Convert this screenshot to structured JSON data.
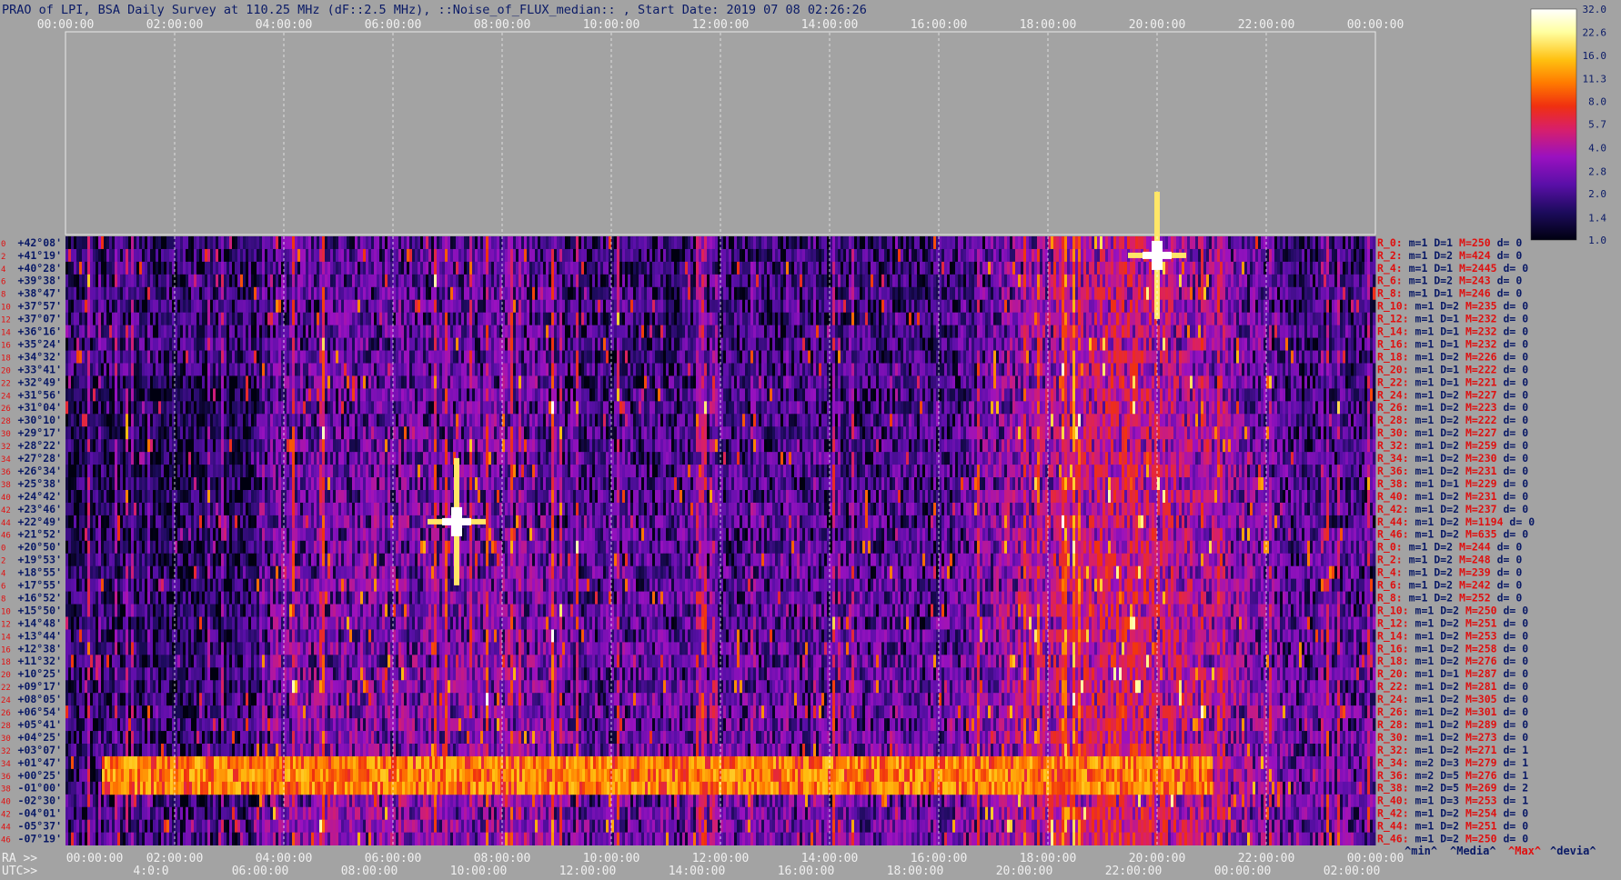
{
  "chart_data": {
    "type": "heatmap",
    "title": "PRAO of LPI, BSA Daily Survey at 110.25 MHz (dF::2.5 MHz), ::Noise_of_FLUX_median:: , Start Date: 2019 07 08 02:26:26",
    "x_top_ticks": [
      "00:00:00",
      "02:00:00",
      "04:00:00",
      "06:00:00",
      "08:00:00",
      "10:00:00",
      "12:00:00",
      "14:00:00",
      "16:00:00",
      "18:00:00",
      "20:00:00",
      "22:00:00",
      "00:00:00"
    ],
    "x_ra_label": "RA >>",
    "x_ra_ticks": [
      "00:00:00",
      "02:00:00",
      "04:00:00",
      "06:00:00",
      "08:00:00",
      "10:00:00",
      "12:00:00",
      "14:00:00",
      "16:00:00",
      "18:00:00",
      "20:00:00",
      "22:00:00",
      "00:00:00"
    ],
    "x_utc_label": "UTC>>",
    "x_utc_ticks": [
      "4:0:0",
      "06:00:00",
      "08:00:00",
      "10:00:00",
      "12:00:00",
      "14:00:00",
      "16:00:00",
      "18:00:00",
      "20:00:00",
      "22:00:00",
      "00:00:00",
      "02:00:00"
    ],
    "row_index_labels": [
      "0",
      "2",
      "4",
      "6",
      "8",
      "10",
      "12",
      "14",
      "16",
      "18",
      "20",
      "22",
      "24",
      "26",
      "28",
      "30",
      "32",
      "34",
      "36",
      "38",
      "40",
      "42",
      "44",
      "46",
      "0",
      "2",
      "4",
      "6",
      "8",
      "10",
      "12",
      "14",
      "16",
      "18",
      "20",
      "22",
      "24",
      "26",
      "28",
      "30",
      "32",
      "34",
      "36",
      "38",
      "40",
      "42",
      "44",
      "46"
    ],
    "declinations": [
      "+42°08'",
      "+41°19'",
      "+40°28'",
      "+39°38'",
      "+38°47'",
      "+37°57'",
      "+37°07'",
      "+36°16'",
      "+35°24'",
      "+34°32'",
      "+33°41'",
      "+32°49'",
      "+31°56'",
      "+31°04'",
      "+30°10'",
      "+29°17'",
      "+28°22'",
      "+27°28'",
      "+26°34'",
      "+25°38'",
      "+24°42'",
      "+23°46'",
      "+22°49'",
      "+21°52'",
      "+20°50'",
      "+19°53'",
      "+18°55'",
      "+17°55'",
      "+16°52'",
      "+15°50'",
      "+14°48'",
      "+13°44'",
      "+12°38'",
      "+11°32'",
      "+10°25'",
      "+09°17'",
      "+08°05'",
      "+06°54'",
      "+05°41'",
      "+04°25'",
      "+03°07'",
      "+01°47'",
      "+00°25'",
      "-01°00'",
      "-02°30'",
      "-04°01'",
      "-05°37'",
      "-07°19'"
    ],
    "row_stats": [
      {
        "r": "R_0:",
        "m": "m=1",
        "D": "D=1",
        "M": "M=250",
        "d": "d= 0"
      },
      {
        "r": "R_2:",
        "m": "m=1",
        "D": "D=2",
        "M": "M=424",
        "d": "d= 0"
      },
      {
        "r": "R_4:",
        "m": "m=1",
        "D": "D=1",
        "M": "M=2445",
        "d": "d= 0"
      },
      {
        "r": "R_6:",
        "m": "m=1",
        "D": "D=2",
        "M": "M=243",
        "d": "d= 0"
      },
      {
        "r": "R_8:",
        "m": "m=1",
        "D": "D=1",
        "M": "M=246",
        "d": "d= 0"
      },
      {
        "r": "R_10:",
        "m": "m=1",
        "D": "D=2",
        "M": "M=235",
        "d": "d= 0"
      },
      {
        "r": "R_12:",
        "m": "m=1",
        "D": "D=1",
        "M": "M=232",
        "d": "d= 0"
      },
      {
        "r": "R_14:",
        "m": "m=1",
        "D": "D=1",
        "M": "M=232",
        "d": "d= 0"
      },
      {
        "r": "R_16:",
        "m": "m=1",
        "D": "D=1",
        "M": "M=232",
        "d": "d= 0"
      },
      {
        "r": "R_18:",
        "m": "m=1",
        "D": "D=2",
        "M": "M=226",
        "d": "d= 0"
      },
      {
        "r": "R_20:",
        "m": "m=1",
        "D": "D=1",
        "M": "M=222",
        "d": "d= 0"
      },
      {
        "r": "R_22:",
        "m": "m=1",
        "D": "D=1",
        "M": "M=221",
        "d": "d= 0"
      },
      {
        "r": "R_24:",
        "m": "m=1",
        "D": "D=2",
        "M": "M=227",
        "d": "d= 0"
      },
      {
        "r": "R_26:",
        "m": "m=1",
        "D": "D=2",
        "M": "M=223",
        "d": "d= 0"
      },
      {
        "r": "R_28:",
        "m": "m=1",
        "D": "D=2",
        "M": "M=222",
        "d": "d= 0"
      },
      {
        "r": "R_30:",
        "m": "m=1",
        "D": "D=2",
        "M": "M=227",
        "d": "d= 0"
      },
      {
        "r": "R_32:",
        "m": "m=1",
        "D": "D=2",
        "M": "M=259",
        "d": "d= 0"
      },
      {
        "r": "R_34:",
        "m": "m=1",
        "D": "D=2",
        "M": "M=230",
        "d": "d= 0"
      },
      {
        "r": "R_36:",
        "m": "m=1",
        "D": "D=2",
        "M": "M=231",
        "d": "d= 0"
      },
      {
        "r": "R_38:",
        "m": "m=1",
        "D": "D=1",
        "M": "M=229",
        "d": "d= 0"
      },
      {
        "r": "R_40:",
        "m": "m=1",
        "D": "D=2",
        "M": "M=231",
        "d": "d= 0"
      },
      {
        "r": "R_42:",
        "m": "m=1",
        "D": "D=2",
        "M": "M=237",
        "d": "d= 0"
      },
      {
        "r": "R_44:",
        "m": "m=1",
        "D": "D=2",
        "M": "M=1194",
        "d": "d= 0"
      },
      {
        "r": "R_46:",
        "m": "m=1",
        "D": "D=2",
        "M": "M=635",
        "d": "d= 0"
      },
      {
        "r": "R_0:",
        "m": "m=1",
        "D": "D=2",
        "M": "M=244",
        "d": "d= 0"
      },
      {
        "r": "R_2:",
        "m": "m=1",
        "D": "D=2",
        "M": "M=248",
        "d": "d= 0"
      },
      {
        "r": "R_4:",
        "m": "m=1",
        "D": "D=2",
        "M": "M=239",
        "d": "d= 0"
      },
      {
        "r": "R_6:",
        "m": "m=1",
        "D": "D=2",
        "M": "M=242",
        "d": "d= 0"
      },
      {
        "r": "R_8:",
        "m": "m=1",
        "D": "D=2",
        "M": "M=252",
        "d": "d= 0"
      },
      {
        "r": "R_10:",
        "m": "m=1",
        "D": "D=2",
        "M": "M=250",
        "d": "d= 0"
      },
      {
        "r": "R_12:",
        "m": "m=1",
        "D": "D=2",
        "M": "M=251",
        "d": "d= 0"
      },
      {
        "r": "R_14:",
        "m": "m=1",
        "D": "D=2",
        "M": "M=253",
        "d": "d= 0"
      },
      {
        "r": "R_16:",
        "m": "m=1",
        "D": "D=2",
        "M": "M=258",
        "d": "d= 0"
      },
      {
        "r": "R_18:",
        "m": "m=1",
        "D": "D=2",
        "M": "M=276",
        "d": "d= 0"
      },
      {
        "r": "R_20:",
        "m": "m=1",
        "D": "D=1",
        "M": "M=287",
        "d": "d= 0"
      },
      {
        "r": "R_22:",
        "m": "m=1",
        "D": "D=2",
        "M": "M=281",
        "d": "d= 0"
      },
      {
        "r": "R_24:",
        "m": "m=1",
        "D": "D=2",
        "M": "M=305",
        "d": "d= 0"
      },
      {
        "r": "R_26:",
        "m": "m=1",
        "D": "D=2",
        "M": "M=301",
        "d": "d= 0"
      },
      {
        "r": "R_28:",
        "m": "m=1",
        "D": "D=2",
        "M": "M=289",
        "d": "d= 0"
      },
      {
        "r": "R_30:",
        "m": "m=1",
        "D": "D=2",
        "M": "M=273",
        "d": "d= 0"
      },
      {
        "r": "R_32:",
        "m": "m=1",
        "D": "D=2",
        "M": "M=271",
        "d": "d= 1"
      },
      {
        "r": "R_34:",
        "m": "m=2",
        "D": "D=3",
        "M": "M=279",
        "d": "d= 1"
      },
      {
        "r": "R_36:",
        "m": "m=2",
        "D": "D=5",
        "M": "M=276",
        "d": "d= 1"
      },
      {
        "r": "R_38:",
        "m": "m=2",
        "D": "D=5",
        "M": "M=269",
        "d": "d= 2"
      },
      {
        "r": "R_40:",
        "m": "m=1",
        "D": "D=3",
        "M": "M=253",
        "d": "d= 1"
      },
      {
        "r": "R_42:",
        "m": "m=1",
        "D": "D=2",
        "M": "M=254",
        "d": "d= 0"
      },
      {
        "r": "R_44:",
        "m": "m=1",
        "D": "D=2",
        "M": "M=251",
        "d": "d= 0"
      },
      {
        "r": "R_46:",
        "m": "m=1",
        "D": "D=2",
        "M": "M=250",
        "d": "d= 0"
      }
    ],
    "legend_footer": [
      "^min^",
      "^Media^",
      "^Max^",
      "^devia^"
    ],
    "colorbar_ticks": [
      "32.0",
      "22.6",
      "16.0",
      "11.3",
      "8.0",
      "5.7",
      "4.0",
      "2.8",
      "2.0",
      "1.4",
      "1.0"
    ],
    "colorbar_scale": "log",
    "colormap": [
      "#000010",
      "#1c0b5c",
      "#5a0fa8",
      "#9a11c0",
      "#d81f6a",
      "#f03010",
      "#ff7a00",
      "#ffc010",
      "#ffffa0",
      "#ffffff"
    ],
    "features": [
      {
        "label": "band",
        "dec_from": "+01°47'",
        "dec_to": "-01°00'",
        "ra_from": "00:40:00",
        "ra_to": "21:00:00",
        "value": 11
      },
      {
        "label": "source",
        "dec": "+22°49'",
        "ra": "07:10:00",
        "value": 32
      },
      {
        "label": "source",
        "dec": "+41°19'",
        "ra": "20:00:00",
        "value": 32
      }
    ]
  }
}
